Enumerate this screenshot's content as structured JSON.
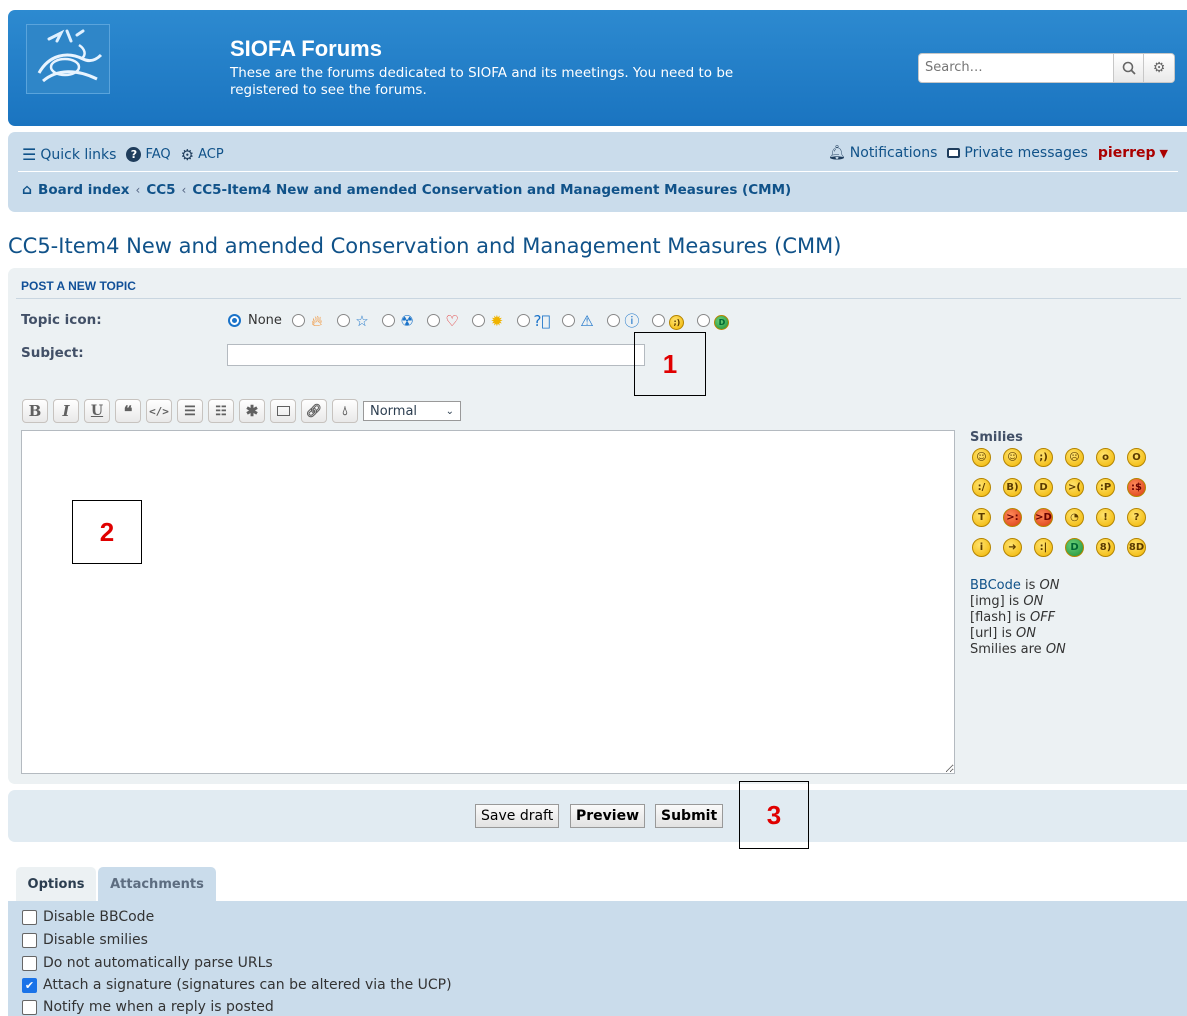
{
  "header": {
    "title": "SIOFA Forums",
    "description": "These are the forums dedicated to SIOFA and its meetings. You need to be registered to see the forums.",
    "search_placeholder": "Search…"
  },
  "nav": {
    "quick_links": "Quick links",
    "faq": "FAQ",
    "acp": "ACP",
    "notifications": "Notifications",
    "private_messages": "Private messages",
    "username": "pierrep"
  },
  "breadcrumbs": [
    "Board index",
    "CC5",
    "CC5-Item4 New and amended Conservation and Management Measures (CMM)"
  ],
  "page_title": "CC5-Item4 New and amended Conservation and Management Measures (CMM)",
  "post_form": {
    "heading": "POST A NEW TOPIC",
    "topic_icon_label": "Topic icon:",
    "topic_icon_none": "None",
    "subject_label": "Subject:",
    "subject_value": "",
    "font_size_selected": "Normal",
    "smilies_title": "Smilies",
    "status": {
      "bbcode": "BBCode",
      "bbcode_state": "ON",
      "img": "[img] is",
      "img_state": "ON",
      "flash": "[flash] is",
      "flash_state": "OFF",
      "url": "[url] is",
      "url_state": "ON",
      "smilies": "Smilies are",
      "smilies_state": "ON"
    }
  },
  "buttons": {
    "save_draft": "Save draft",
    "preview": "Preview",
    "submit": "Submit"
  },
  "tabs": {
    "options": "Options",
    "attachments": "Attachments"
  },
  "options": [
    {
      "label": "Disable BBCode",
      "checked": false
    },
    {
      "label": "Disable smilies",
      "checked": false
    },
    {
      "label": "Do not automatically parse URLs",
      "checked": false
    },
    {
      "label": "Attach a signature (signatures can be altered via the UCP)",
      "checked": true
    },
    {
      "label": "Notify me when a reply is posted",
      "checked": false
    }
  ],
  "annotations": [
    "1",
    "2",
    "3"
  ]
}
